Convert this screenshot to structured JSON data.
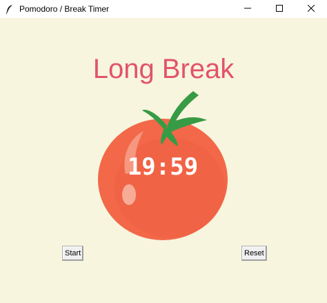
{
  "window": {
    "title": "Pomodoro / Break Timer",
    "icon": "feather-icon",
    "controls": [
      "minimize-icon",
      "maximize-icon",
      "close-icon"
    ]
  },
  "main": {
    "mode_label": "Long Break",
    "timer": "19:59",
    "image": "tomato-image",
    "start_label": "Start",
    "reset_label": "Reset"
  },
  "colors": {
    "background": "#f7f5dd",
    "mode_label": "#e2536a",
    "tomato": "#f26849",
    "leaf": "#379b46",
    "timer_text": "#ffffff"
  }
}
